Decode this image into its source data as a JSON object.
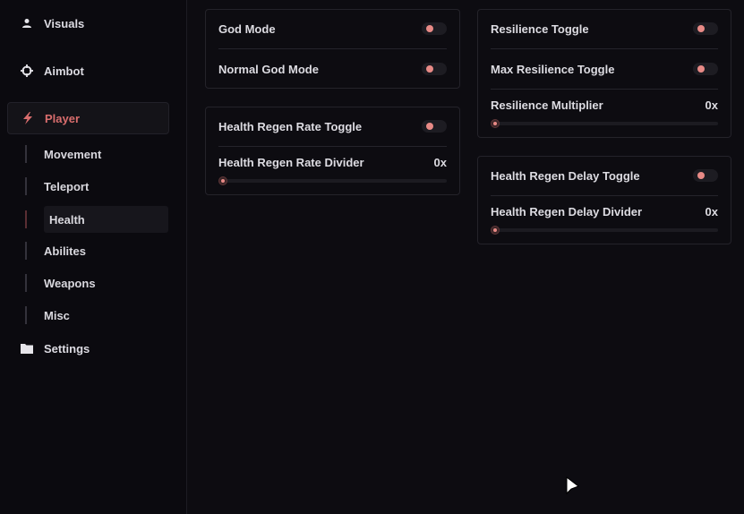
{
  "sidebar": {
    "items": [
      {
        "label": "Visuals",
        "icon": "user-icon"
      },
      {
        "label": "Aimbot",
        "icon": "crosshair-icon"
      },
      {
        "label": "Player",
        "icon": "lightning-icon",
        "active": true
      },
      {
        "label": "Settings",
        "icon": "folder-icon"
      }
    ],
    "subitems": [
      {
        "label": "Movement"
      },
      {
        "label": "Teleport"
      },
      {
        "label": "Health",
        "active": true
      },
      {
        "label": "Abilites"
      },
      {
        "label": "Weapons"
      },
      {
        "label": "Misc"
      }
    ]
  },
  "panels": {
    "god": {
      "god_mode": "God Mode",
      "normal_god_mode": "Normal God Mode"
    },
    "regen_rate": {
      "toggle_label": "Health Regen Rate Toggle",
      "divider_label": "Health Regen Rate Divider",
      "divider_value": "0x"
    },
    "resilience": {
      "toggle_label": "Resilience Toggle",
      "max_toggle_label": "Max Resilience Toggle",
      "multiplier_label": "Resilience Multiplier",
      "multiplier_value": "0x"
    },
    "regen_delay": {
      "toggle_label": "Health Regen Delay Toggle",
      "divider_label": "Health Regen Delay Divider",
      "divider_value": "0x"
    }
  },
  "colors": {
    "accent": "#d96d6d",
    "knob": "#e88a86",
    "background": "#0d0c11"
  }
}
